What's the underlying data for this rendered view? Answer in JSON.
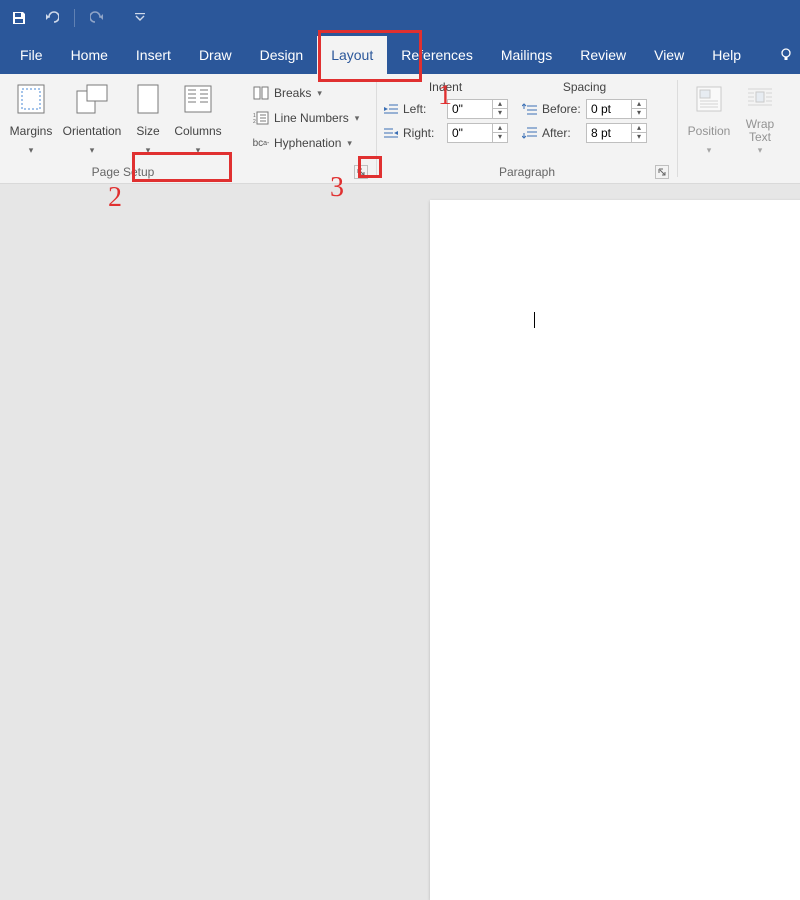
{
  "qat": {
    "save": "save-icon",
    "undo": "undo-icon",
    "redo": "redo-icon",
    "customize": "customize-icon"
  },
  "tabs": {
    "file": "File",
    "home": "Home",
    "insert": "Insert",
    "draw": "Draw",
    "design": "Design",
    "layout": "Layout",
    "references": "References",
    "mailings": "Mailings",
    "review": "Review",
    "view": "View",
    "help": "Help"
  },
  "ribbon": {
    "page_setup": {
      "label": "Page Setup",
      "margins": "Margins",
      "orientation": "Orientation",
      "size": "Size",
      "columns": "Columns",
      "breaks": "Breaks",
      "line_numbers": "Line Numbers",
      "hyphenation": "Hyphenation"
    },
    "paragraph": {
      "label": "Paragraph",
      "indent_head": "Indent",
      "spacing_head": "Spacing",
      "left_label": "Left:",
      "right_label": "Right:",
      "before_label": "Before:",
      "after_label": "After:",
      "left_val": "0\"",
      "right_val": "0\"",
      "before_val": "0 pt",
      "after_val": "8 pt"
    },
    "arrange": {
      "position": "Position",
      "wrap_text": "Wrap\nText"
    }
  },
  "annotations": {
    "n1": "1",
    "n2": "2",
    "n3": "3"
  },
  "colors": {
    "brand": "#2b579a",
    "anno": "#e03030"
  }
}
